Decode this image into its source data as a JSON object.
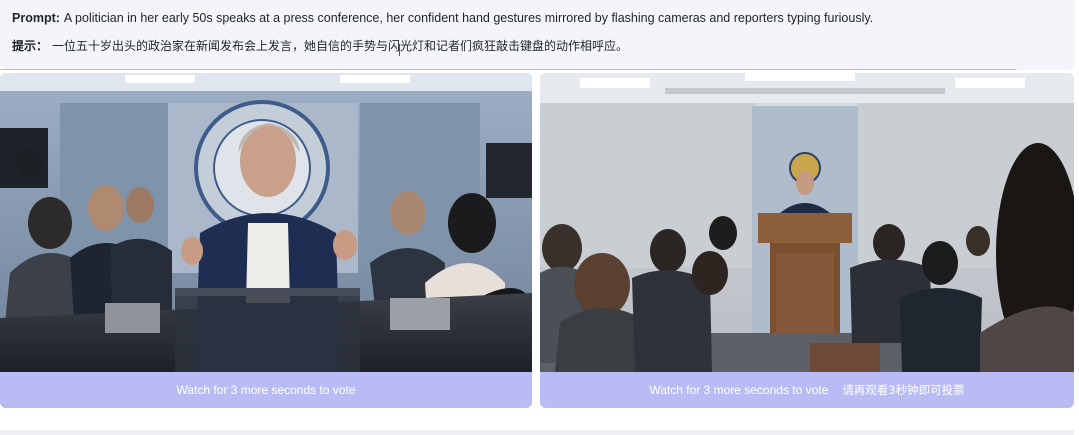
{
  "prompt": {
    "en_label": "Prompt:",
    "en_text": "A politician in her early 50s speaks at a press conference, her confident hand gestures mirrored by flashing cameras and reporters typing furiously.",
    "zh_label": "提示：",
    "zh_text": "一位五十岁出头的政治家在新闻发布会上发言，她自信的手势与闪光灯和记者们疯狂敲击键盘的动作相呼应。"
  },
  "videos": [
    {
      "vote_text": "Watch for 3 more seconds to vote",
      "vote_text_zh": ""
    },
    {
      "vote_text": "Watch for 3 more seconds to vote",
      "vote_text_zh": "请再观看3秒钟即可投票"
    }
  ],
  "colors": {
    "vote_bar": "#b9bcf4",
    "panel_bg": "#f3f5fa"
  }
}
